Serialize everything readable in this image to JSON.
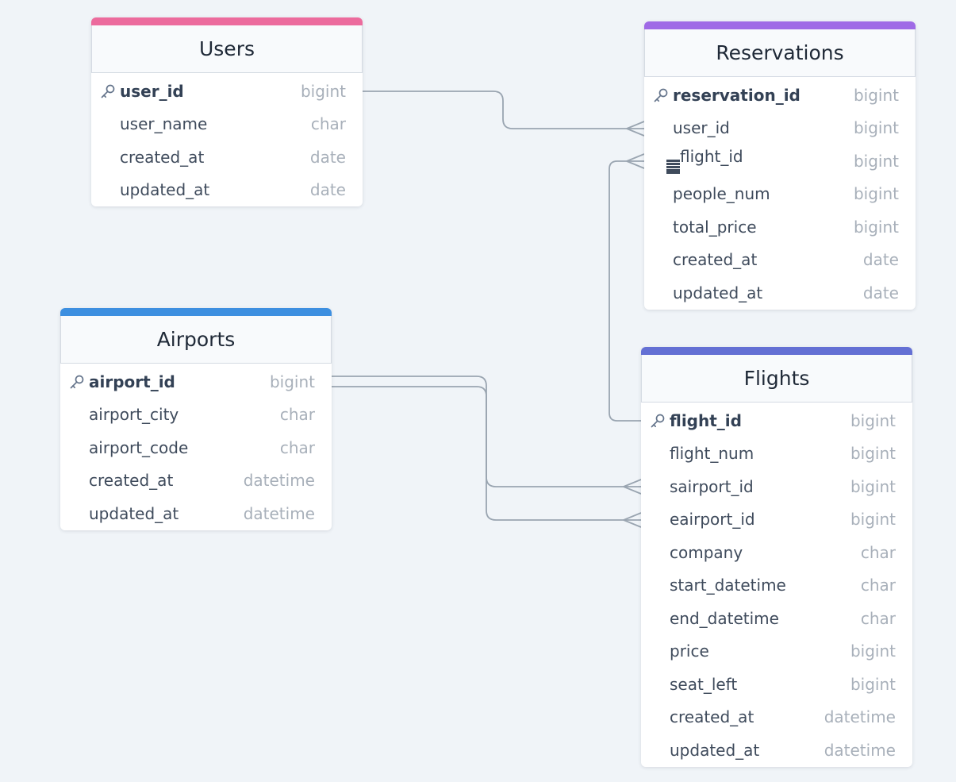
{
  "diagram": {
    "tables": [
      {
        "id": "users",
        "title": "Users",
        "accent": "#ec6b9d",
        "fields": [
          {
            "name": "user_id",
            "type": "bigint",
            "pk": true
          },
          {
            "name": "user_name",
            "type": "char"
          },
          {
            "name": "created_at",
            "type": "date"
          },
          {
            "name": "updated_at",
            "type": "date"
          }
        ]
      },
      {
        "id": "reservations",
        "title": "Reservations",
        "accent": "#9f6ae6",
        "fields": [
          {
            "name": "reservation_id",
            "type": "bigint",
            "pk": true
          },
          {
            "name": "user_id",
            "type": "bigint"
          },
          {
            "name": "flight_id",
            "type": "bigint",
            "index": true
          },
          {
            "name": "people_num",
            "type": "bigint"
          },
          {
            "name": "total_price",
            "type": "bigint"
          },
          {
            "name": "created_at",
            "type": "date"
          },
          {
            "name": "updated_at",
            "type": "date"
          }
        ]
      },
      {
        "id": "airports",
        "title": "Airports",
        "accent": "#3d8fe0",
        "fields": [
          {
            "name": "airport_id",
            "type": "bigint",
            "pk": true
          },
          {
            "name": "airport_city",
            "type": "char"
          },
          {
            "name": "airport_code",
            "type": "char"
          },
          {
            "name": "created_at",
            "type": "datetime"
          },
          {
            "name": "updated_at",
            "type": "datetime"
          }
        ]
      },
      {
        "id": "flights",
        "title": "Flights",
        "accent": "#6470d4",
        "fields": [
          {
            "name": "flight_id",
            "type": "bigint",
            "pk": true
          },
          {
            "name": "flight_num",
            "type": "bigint"
          },
          {
            "name": "sairport_id",
            "type": "bigint"
          },
          {
            "name": "eairport_id",
            "type": "bigint"
          },
          {
            "name": "company",
            "type": "char"
          },
          {
            "name": "start_datetime",
            "type": "char"
          },
          {
            "name": "end_datetime",
            "type": "char"
          },
          {
            "name": "price",
            "type": "bigint"
          },
          {
            "name": "seat_left",
            "type": "bigint"
          },
          {
            "name": "created_at",
            "type": "datetime"
          },
          {
            "name": "updated_at",
            "type": "datetime"
          }
        ]
      }
    ],
    "relations": [
      {
        "from": "users.user_id",
        "to": "reservations.user_id",
        "cardinality": "one-to-many"
      },
      {
        "from": "flights.flight_id",
        "to": "reservations.flight_id",
        "cardinality": "one-to-many"
      },
      {
        "from": "airports.airport_id",
        "to": "flights.sairport_id",
        "cardinality": "one-to-many"
      },
      {
        "from": "airports.airport_id",
        "to": "flights.eairport_id",
        "cardinality": "one-to-many"
      }
    ],
    "colors": {
      "background": "#f0f4f8",
      "connector": "#9aa5b1"
    },
    "icons": {
      "primary_key": "key-icon",
      "index": "index-icon"
    }
  }
}
